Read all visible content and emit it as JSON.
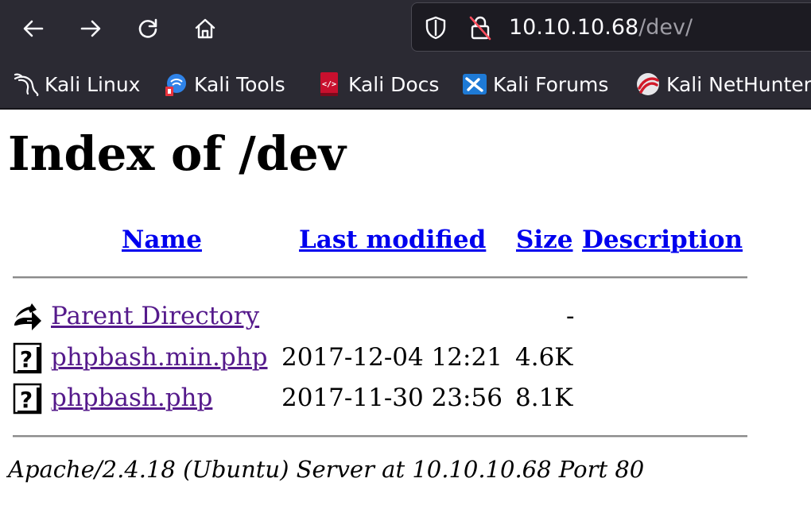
{
  "browser": {
    "url_host": "10.10.10.68",
    "url_path": "/dev/",
    "bookmarks": [
      {
        "label": "Kali Linux",
        "icon": "kali-dragon-icon"
      },
      {
        "label": "Kali Tools",
        "icon": "kali-tools-icon"
      },
      {
        "label": "Kali Docs",
        "icon": "kali-docs-icon"
      },
      {
        "label": "Kali Forums",
        "icon": "kali-forums-icon"
      },
      {
        "label": "Kali NetHunter",
        "icon": "kali-nethunter-icon"
      }
    ]
  },
  "page": {
    "title": "Index of /dev",
    "columns": {
      "name": "Name",
      "last_modified": "Last modified",
      "size": "Size",
      "description": "Description"
    },
    "rows": [
      {
        "name": "Parent Directory",
        "modified": "",
        "size": "-",
        "icon": "back-arrow-icon"
      },
      {
        "name": "phpbash.min.php",
        "modified": "2017-12-04 12:21",
        "size": "4.6K",
        "icon": "unknown-file-icon"
      },
      {
        "name": "phpbash.php",
        "modified": "2017-11-30 23:56",
        "size": "8.1K",
        "icon": "unknown-file-icon"
      }
    ],
    "footer": "Apache/2.4.18 (Ubuntu) Server at 10.10.10.68 Port 80"
  },
  "colors": {
    "toolbar_bg": "#2b2a33",
    "urlbar_bg": "#1c1b22",
    "link": "#0000ee",
    "visited_link": "#551a8b"
  }
}
